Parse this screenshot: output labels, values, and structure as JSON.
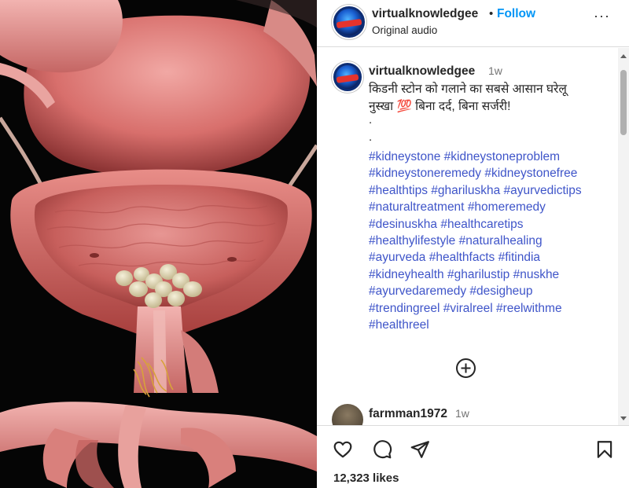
{
  "post": {
    "username": "virtualknowledgee",
    "separator": "•",
    "follow_label": "Follow",
    "audio_label": "Original audio",
    "more_label": "···"
  },
  "caption": {
    "username": "virtualknowledgee",
    "time": "1w",
    "line1": "किडनी स्टोन को गलाने का सबसे आसान घरेलू",
    "line2": "नुस्खा 💯 बिना दर्द, बिना सर्जरी!",
    "dot1": ".",
    "dot2": ".",
    "hashtag_lines": [
      [
        "#kidneystone",
        "#kidneystoneproblem"
      ],
      [
        "#kidneystoneremedy",
        "#kidneystonefree"
      ],
      [
        "#healthtips",
        "#ghariluskha",
        "#ayurvedictips"
      ],
      [
        "#naturaltreatment",
        "#homeremedy"
      ],
      [
        "#desinuskha",
        "#healthcaretips"
      ],
      [
        "#healthylifestyle",
        "#naturalhealing"
      ],
      [
        "#ayurveda",
        "#healthfacts",
        "#fitindia"
      ],
      [
        "#kidneyhealth",
        "#gharilustip",
        "#nuskhe"
      ],
      [
        "#ayurvedaremedy",
        "#desigheup"
      ],
      [
        "#trendingreel",
        "#viralreel",
        "#reelwithme"
      ],
      [
        "#healthreel"
      ]
    ]
  },
  "comment": {
    "username": "farmman1972",
    "time": "1w"
  },
  "footer": {
    "likes": "12,323 likes"
  },
  "icons": {
    "heart": "heart-icon",
    "comment": "comment-icon",
    "share": "send-icon",
    "save": "bookmark-icon",
    "more_comments": "plus-circle-icon"
  },
  "colors": {
    "accent": "#0095f6",
    "hashtag": "#3f55c9",
    "muted": "#737373",
    "text": "#262626"
  }
}
